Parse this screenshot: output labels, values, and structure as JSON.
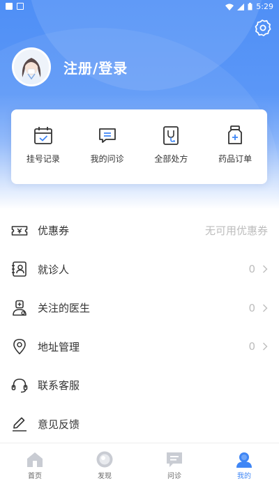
{
  "status_bar": {
    "time": "5:29"
  },
  "profile": {
    "login_label": "注册/登录"
  },
  "quick_actions": [
    {
      "label": "挂号记录",
      "icon": "calendar-check-icon"
    },
    {
      "label": "我的问诊",
      "icon": "chat-icon"
    },
    {
      "label": "全部处方",
      "icon": "prescription-icon"
    },
    {
      "label": "药品订单",
      "icon": "medicine-bottle-icon"
    }
  ],
  "menu": [
    {
      "label": "优惠券",
      "value": "无可用优惠券",
      "icon": "coupon-icon"
    },
    {
      "label": "就诊人",
      "value": "0",
      "icon": "patient-card-icon"
    },
    {
      "label": "关注的医生",
      "value": "0",
      "icon": "doctor-icon"
    },
    {
      "label": "地址管理",
      "value": "0",
      "icon": "location-icon"
    },
    {
      "label": "联系客服",
      "value": "",
      "icon": "headset-icon"
    },
    {
      "label": "意见反馈",
      "value": "",
      "icon": "pen-icon"
    }
  ],
  "tabs": [
    {
      "label": "首页",
      "icon": "home-icon",
      "active": false
    },
    {
      "label": "发现",
      "icon": "discover-icon",
      "active": false
    },
    {
      "label": "问诊",
      "icon": "consult-icon",
      "active": false
    },
    {
      "label": "我的",
      "icon": "user-icon",
      "active": true
    }
  ],
  "colors": {
    "accent": "#3f86f5",
    "header_top": "#4f8ff6",
    "icon_stroke": "#333333",
    "muted": "#bdbdbd"
  }
}
